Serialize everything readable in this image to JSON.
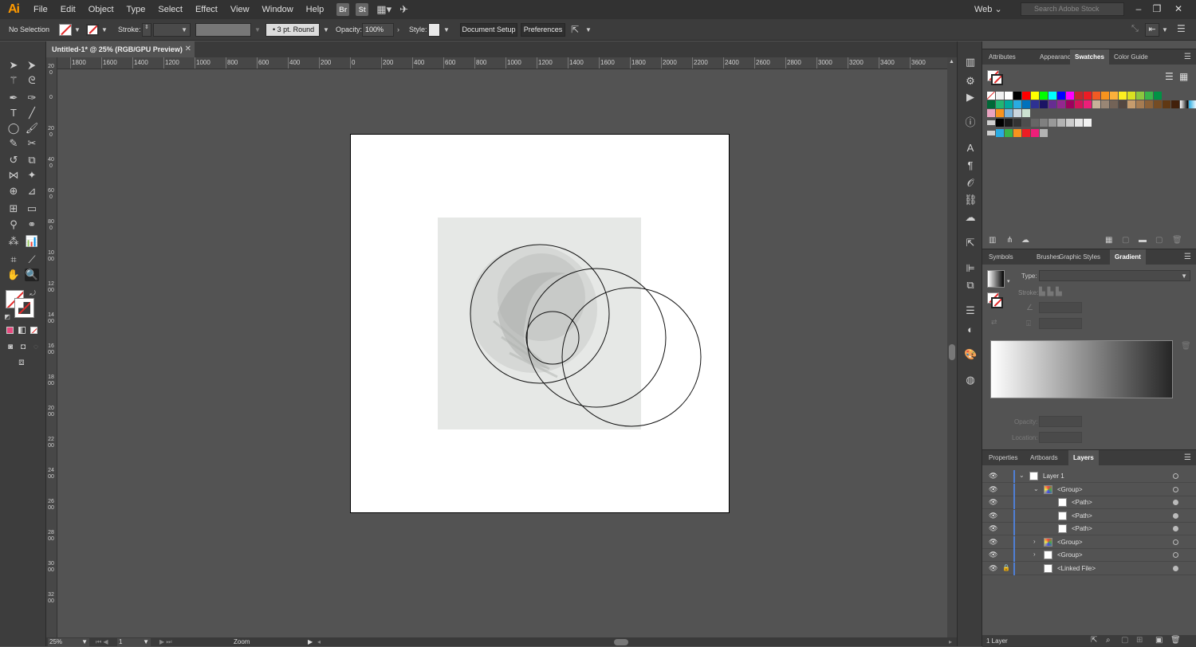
{
  "app": {
    "logo": "Ai",
    "menus": [
      "File",
      "Edit",
      "Object",
      "Type",
      "Select",
      "Effect",
      "View",
      "Window",
      "Help"
    ],
    "bridge_badge": "Br",
    "stock_badge": "St",
    "workspace": "Web",
    "stock_search_placeholder": "Search Adobe Stock"
  },
  "control_bar": {
    "selection_label": "No Selection",
    "stroke_label": "Stroke:",
    "brush_value": "3 pt. Round",
    "opacity_label": "Opacity:",
    "opacity_value": "100%",
    "style_label": "Style:",
    "document_setup": "Document Setup",
    "preferences": "Preferences"
  },
  "document": {
    "tab_title": "Untitled-1* @ 25% (RGB/GPU Preview)",
    "zoom": "25%",
    "artboard_number": "1",
    "status_text": "Zoom"
  },
  "ruler": {
    "h_ticks": [
      "1800",
      "1600",
      "1400",
      "1200",
      "1000",
      "800",
      "600",
      "400",
      "200",
      "0",
      "200",
      "400",
      "600",
      "800",
      "1000",
      "1200",
      "1400",
      "1600",
      "1800",
      "2000",
      "2200",
      "2400",
      "2600",
      "2800",
      "3000",
      "3200",
      "3400",
      "3600"
    ],
    "v_ticks": [
      "200",
      "0",
      "200",
      "400",
      "600",
      "800",
      "1000",
      "1200",
      "1400",
      "1600",
      "1800",
      "2000",
      "2200",
      "2400",
      "2600",
      "2800",
      "3000",
      "3200"
    ]
  },
  "panels": {
    "top_tabs": [
      "Attributes",
      "Appearance",
      "Swatches",
      "Color Guide"
    ],
    "middle_tabs": [
      "Symbols",
      "Brushes",
      "Graphic Styles",
      "Gradient"
    ],
    "gradient": {
      "type_label": "Type:",
      "stroke_label": "Stroke:",
      "opacity_label": "Opacity:",
      "location_label": "Location:"
    },
    "bottom_tabs": [
      "Properties",
      "Artboards",
      "Layers"
    ],
    "layers": [
      {
        "name": "Layer 1",
        "indent": 0,
        "expander": "open",
        "locked": false,
        "target": "empty"
      },
      {
        "name": "<Group>",
        "indent": 1,
        "expander": "open",
        "locked": false,
        "target": "empty"
      },
      {
        "name": "<Path>",
        "indent": 2,
        "expander": "none",
        "locked": false,
        "target": "filled"
      },
      {
        "name": "<Path>",
        "indent": 2,
        "expander": "none",
        "locked": false,
        "target": "filled"
      },
      {
        "name": "<Path>",
        "indent": 2,
        "expander": "none",
        "locked": false,
        "target": "filled"
      },
      {
        "name": "<Group>",
        "indent": 1,
        "expander": "closed",
        "locked": false,
        "target": "empty"
      },
      {
        "name": "<Group>",
        "indent": 1,
        "expander": "closed",
        "locked": false,
        "target": "empty"
      },
      {
        "name": "<Linked File>",
        "indent": 1,
        "expander": "none",
        "locked": true,
        "target": "filled"
      }
    ],
    "layers_count": "1 Layer"
  },
  "swatch_colors": {
    "row1": [
      "#ffffff",
      "#000000",
      "#ff0000",
      "#ffff00",
      "#00ff00",
      "#00ffff",
      "#0000ff",
      "#ff00ff",
      "#c1272d",
      "#ed1c24",
      "#f15a24",
      "#f7931e",
      "#fbb03b",
      "#fcee21",
      "#d9e021",
      "#8cc63f",
      "#39b54a",
      "#009245"
    ],
    "row2": [
      "#006837",
      "#22b573",
      "#00a99d",
      "#29abe2",
      "#0071bc",
      "#2e3192",
      "#1b1464",
      "#662d91",
      "#93278f",
      "#9e005d",
      "#d4145a",
      "#ed1e79",
      "#c7b299",
      "#998675",
      "#736357",
      "#534741",
      "#c69c6d",
      "#a67c52",
      "#8c6239",
      "#754c24",
      "#603813",
      "#42210b"
    ],
    "row4": [
      "#000000",
      "#1a1a1a",
      "#333333",
      "#4d4d4d",
      "#666666",
      "#808080",
      "#999999",
      "#b3b3b3",
      "#cccccc",
      "#e6e6e6",
      "#f2f2f2"
    ],
    "row5": [
      "#29abe2",
      "#39b54a",
      "#f7931e",
      "#ed1c24",
      "#ed1e79",
      "#b3b3b3"
    ]
  }
}
